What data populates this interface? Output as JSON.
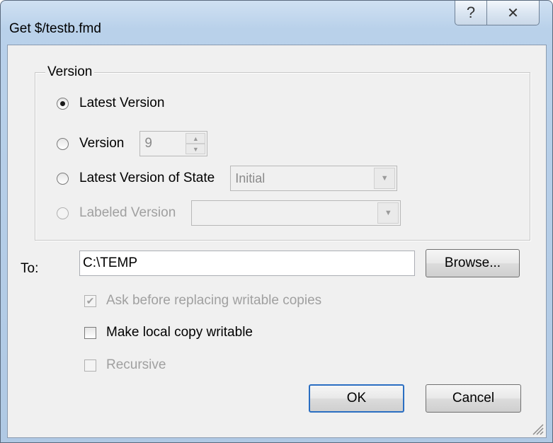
{
  "window": {
    "title": "Get $/testb.fmd",
    "help_glyph": "?",
    "close_glyph": "✕"
  },
  "version_group": {
    "label": "Version",
    "options": [
      {
        "label": "Latest Version",
        "checked": true,
        "disabled": false
      },
      {
        "label": "Version",
        "checked": false,
        "disabled": false
      },
      {
        "label": "Latest Version of State",
        "checked": false,
        "disabled": false
      },
      {
        "label": "Labeled Version",
        "checked": false,
        "disabled": true
      }
    ],
    "version_spinner_value": "9",
    "state_combo_value": "Initial",
    "label_combo_value": ""
  },
  "destination": {
    "label": "To:",
    "value": "C:\\TEMP",
    "browse_label": "Browse..."
  },
  "checkboxes": [
    {
      "label": "Ask before replacing writable copies",
      "checked": true,
      "disabled": true
    },
    {
      "label": "Make local copy writable",
      "checked": false,
      "disabled": false
    },
    {
      "label": "Recursive",
      "checked": false,
      "disabled": true
    }
  ],
  "buttons": {
    "ok": "OK",
    "cancel": "Cancel"
  }
}
